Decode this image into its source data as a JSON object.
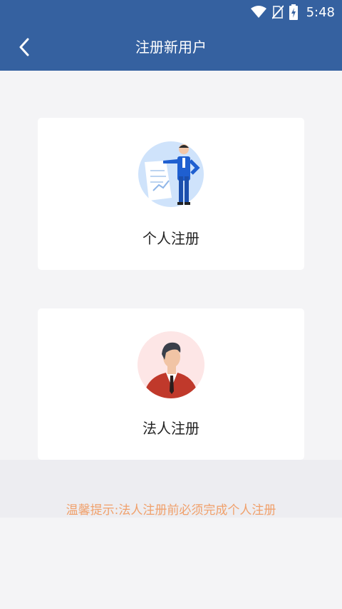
{
  "status_bar": {
    "time": "5:48",
    "icons": [
      "wifi-icon",
      "no-sim-icon",
      "battery-charging-icon"
    ]
  },
  "app_bar": {
    "title": "注册新用户",
    "back_icon": "chevron-left-icon"
  },
  "cards": [
    {
      "label": "个人注册",
      "illustration": "businessman-with-document-illustration"
    },
    {
      "label": "法人注册",
      "illustration": "man-in-red-suit-avatar-illustration"
    }
  ],
  "tip": {
    "text": "温馨提示:法人注册前必须完成个人注册"
  },
  "colors": {
    "primary": "#3561a0",
    "background": "#f4f4f6",
    "tip_text": "#f0a06b",
    "card_bg": "#ffffff"
  }
}
